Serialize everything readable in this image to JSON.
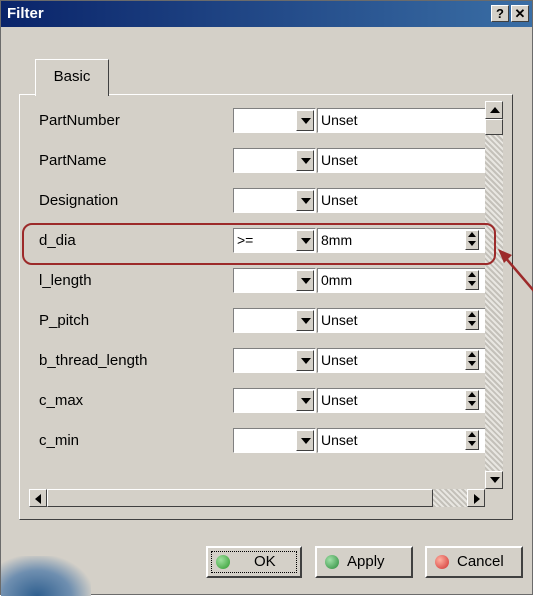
{
  "window": {
    "title": "Filter",
    "help_label": "?",
    "close_label": "✕"
  },
  "tab": {
    "label": "Basic"
  },
  "rows": [
    {
      "name": "PartNumber",
      "op": "",
      "value": "Unset",
      "spin": false
    },
    {
      "name": "PartName",
      "op": "",
      "value": "Unset",
      "spin": false
    },
    {
      "name": "Designation",
      "op": "",
      "value": "Unset",
      "spin": false
    },
    {
      "name": "d_dia",
      "op": ">=",
      "value": "8mm",
      "spin": true
    },
    {
      "name": "l_length",
      "op": "",
      "value": "0mm",
      "spin": true
    },
    {
      "name": "P_pitch",
      "op": "",
      "value": "Unset",
      "spin": true
    },
    {
      "name": "b_thread_length",
      "op": "",
      "value": "Unset",
      "spin": true
    },
    {
      "name": "c_max",
      "op": "",
      "value": "Unset",
      "spin": true
    },
    {
      "name": "c_min",
      "op": "",
      "value": "Unset",
      "spin": true
    }
  ],
  "buttons": {
    "ok": "OK",
    "apply": "Apply",
    "cancel": "Cancel"
  },
  "colors": {
    "highlight": "#9c2a2a",
    "ok_dot": "#2e9a2e",
    "apply_dot": "#2a8a3a",
    "cancel_dot": "#d03030"
  }
}
